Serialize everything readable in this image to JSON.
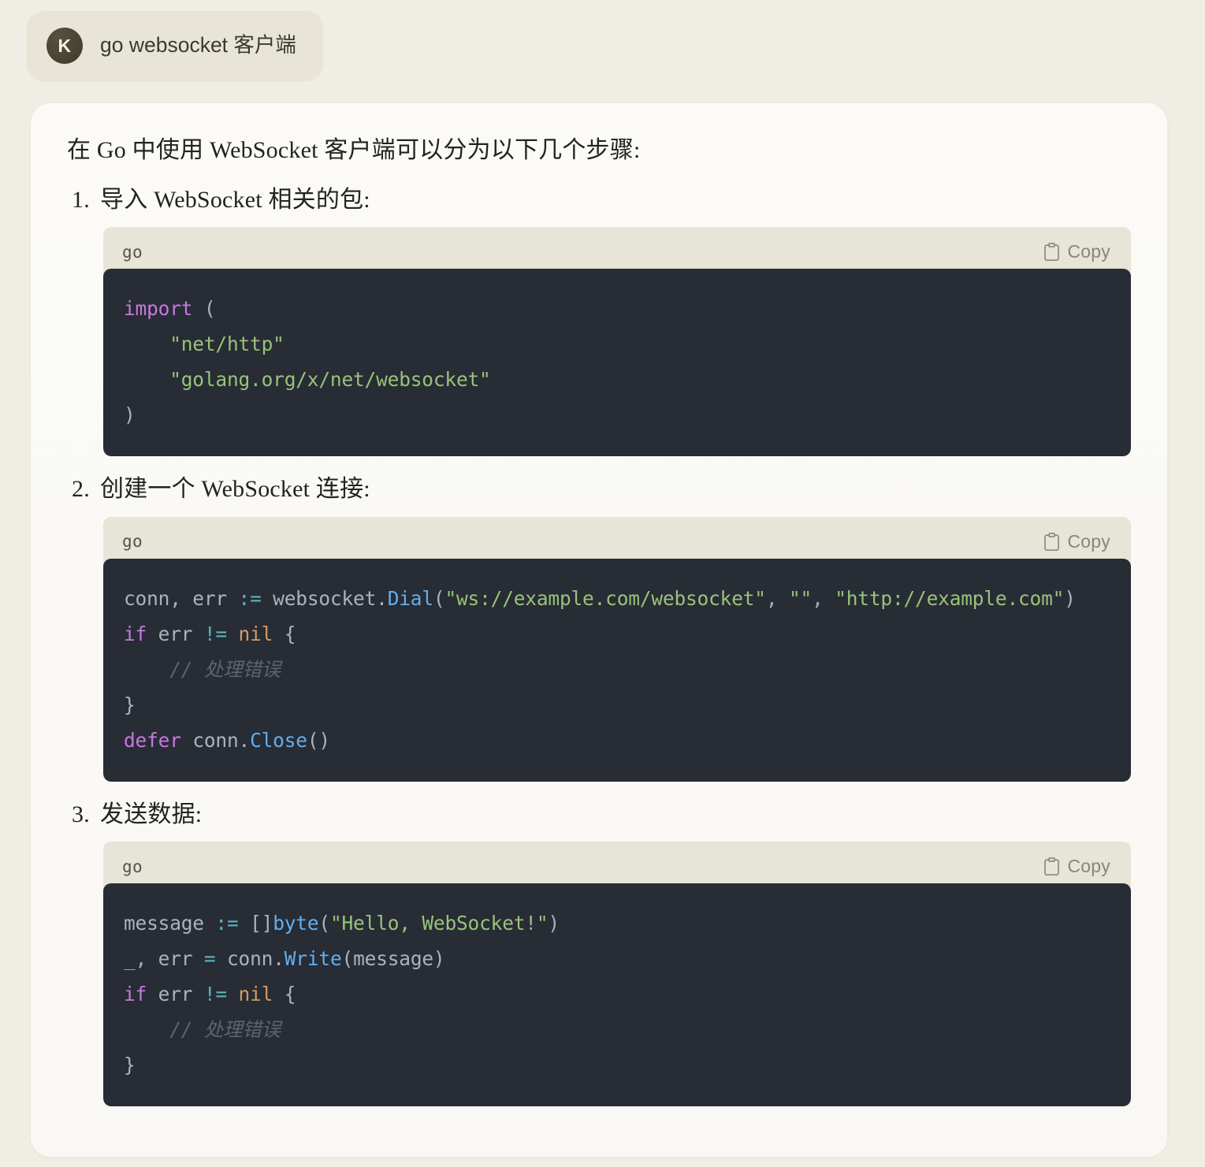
{
  "user_message": {
    "avatar_initial": "K",
    "text": "go websocket 客户端"
  },
  "answer": {
    "intro": "在 Go 中使用 WebSocket 客户端可以分为以下几个步骤:",
    "steps": [
      {
        "number": "1.",
        "title": "导入 WebSocket 相关的包:",
        "code": {
          "language_label": "go",
          "copy_label": "Copy",
          "plain_text": "import (\n    \"net/http\"\n    \"golang.org/x/net/websocket\"\n)",
          "tokens": [
            [
              {
                "t": "import",
                "c": "tok-kw"
              },
              {
                "t": " ",
                "c": ""
              },
              {
                "t": "(",
                "c": "tok-punct"
              }
            ],
            [
              {
                "t": "    ",
                "c": ""
              },
              {
                "t": "\"net/http\"",
                "c": "tok-str"
              }
            ],
            [
              {
                "t": "    ",
                "c": ""
              },
              {
                "t": "\"golang.org/x/net/websocket\"",
                "c": "tok-str"
              }
            ],
            [
              {
                "t": ")",
                "c": "tok-punct"
              }
            ]
          ]
        }
      },
      {
        "number": "2.",
        "title": "创建一个 WebSocket 连接:",
        "code": {
          "language_label": "go",
          "copy_label": "Copy",
          "plain_text": "conn, err := websocket.Dial(\"ws://example.com/websocket\", \"\", \"http://example.com\")\nif err != nil {\n    // 处理错误\n}\ndefer conn.Close()",
          "tokens": [
            [
              {
                "t": "conn, err ",
                "c": ""
              },
              {
                "t": ":=",
                "c": "tok-op"
              },
              {
                "t": " websocket.",
                "c": ""
              },
              {
                "t": "Dial",
                "c": "tok-fn"
              },
              {
                "t": "(",
                "c": "tok-punct"
              },
              {
                "t": "\"ws://example.com/websocket\"",
                "c": "tok-str"
              },
              {
                "t": ", ",
                "c": "tok-punct"
              },
              {
                "t": "\"\"",
                "c": "tok-str"
              },
              {
                "t": ", ",
                "c": "tok-punct"
              },
              {
                "t": "\"http://example.com\"",
                "c": "tok-str"
              },
              {
                "t": ")",
                "c": "tok-punct"
              }
            ],
            [
              {
                "t": "if",
                "c": "tok-kw"
              },
              {
                "t": " err ",
                "c": ""
              },
              {
                "t": "!=",
                "c": "tok-op"
              },
              {
                "t": " ",
                "c": ""
              },
              {
                "t": "nil",
                "c": "tok-num"
              },
              {
                "t": " {",
                "c": "tok-punct"
              }
            ],
            [
              {
                "t": "    ",
                "c": ""
              },
              {
                "t": "// 处理错误",
                "c": "tok-cmt"
              }
            ],
            [
              {
                "t": "}",
                "c": "tok-punct"
              }
            ],
            [
              {
                "t": "defer",
                "c": "tok-kw"
              },
              {
                "t": " conn.",
                "c": ""
              },
              {
                "t": "Close",
                "c": "tok-fn"
              },
              {
                "t": "()",
                "c": "tok-punct"
              }
            ]
          ]
        }
      },
      {
        "number": "3.",
        "title": "发送数据:",
        "code": {
          "language_label": "go",
          "copy_label": "Copy",
          "plain_text": "message := []byte(\"Hello, WebSocket!\")\n_, err = conn.Write(message)\nif err != nil {\n    // 处理错误\n}",
          "tokens": [
            [
              {
                "t": "message ",
                "c": ""
              },
              {
                "t": ":=",
                "c": "tok-op"
              },
              {
                "t": " ",
                "c": ""
              },
              {
                "t": "[]",
                "c": "tok-punct"
              },
              {
                "t": "byte",
                "c": "tok-type"
              },
              {
                "t": "(",
                "c": "tok-punct"
              },
              {
                "t": "\"Hello, WebSocket!\"",
                "c": "tok-str"
              },
              {
                "t": ")",
                "c": "tok-punct"
              }
            ],
            [
              {
                "t": "_",
                "c": "tok-num"
              },
              {
                "t": ", err ",
                "c": ""
              },
              {
                "t": "=",
                "c": "tok-op"
              },
              {
                "t": " conn.",
                "c": ""
              },
              {
                "t": "Write",
                "c": "tok-fn"
              },
              {
                "t": "(message)",
                "c": "tok-punct"
              }
            ],
            [
              {
                "t": "if",
                "c": "tok-kw"
              },
              {
                "t": " err ",
                "c": ""
              },
              {
                "t": "!=",
                "c": "tok-op"
              },
              {
                "t": " ",
                "c": ""
              },
              {
                "t": "nil",
                "c": "tok-num"
              },
              {
                "t": " {",
                "c": "tok-punct"
              }
            ],
            [
              {
                "t": "    ",
                "c": ""
              },
              {
                "t": "// 处理错误",
                "c": "tok-cmt"
              }
            ],
            [
              {
                "t": "}",
                "c": "tok-punct"
              }
            ]
          ]
        }
      }
    ]
  },
  "colors": {
    "page_bg": "#f0ede4",
    "card_bg": "#fbfaf7",
    "user_bubble_bg": "#e8e5d6",
    "avatar_bg": "#46422f",
    "code_header_bg": "#e7e4d8",
    "code_bg": "#282c35",
    "code_default_text": "#abb2bf",
    "keyword": "#c678dd",
    "string": "#98c379",
    "function": "#61afef",
    "operator": "#56b6c2",
    "constant": "#d19a66",
    "comment": "#5c6370",
    "copy_label": "#8a8677"
  },
  "icons": {
    "clipboard": "clipboard-icon"
  }
}
